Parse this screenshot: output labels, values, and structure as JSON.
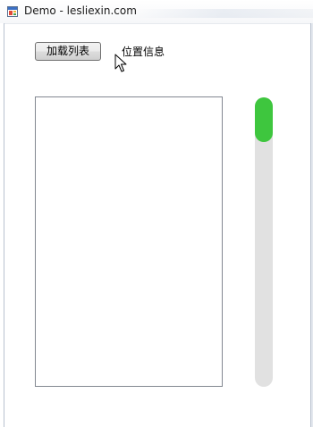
{
  "window": {
    "title": "Demo - lesliexin.com"
  },
  "toolbar": {
    "load_button_label": "加载列表",
    "position_label": "位置信息"
  },
  "list": {
    "items": []
  },
  "scrollbar": {
    "position_fraction": 0.0,
    "thumb_color": "#3ec63e",
    "track_color": "#e1e1e1"
  },
  "icons": {
    "app": "app-window-icon",
    "cursor": "mouse-pointer-icon"
  }
}
